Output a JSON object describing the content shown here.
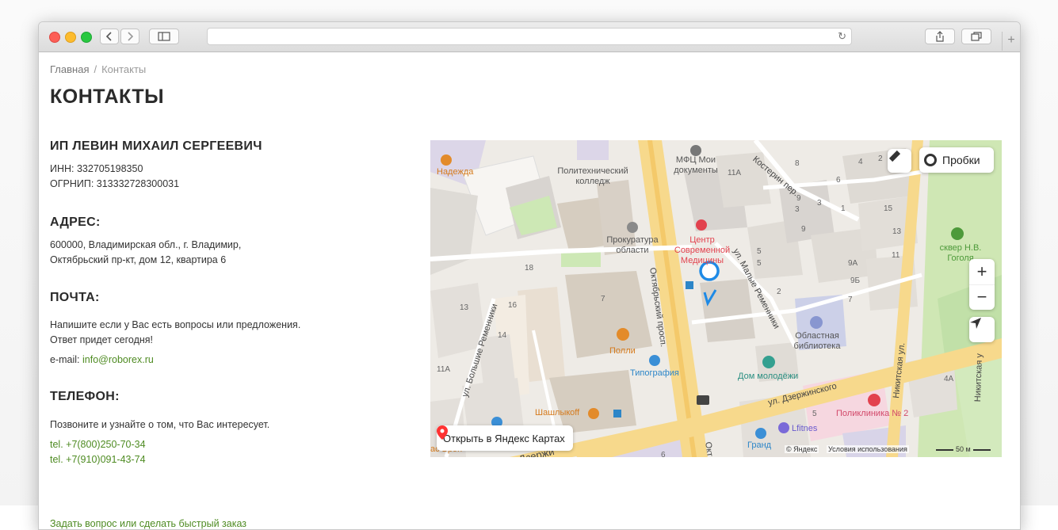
{
  "browser": {
    "back_icon": "chevron-left-icon",
    "forward_icon": "chevron-right-icon",
    "sidebar_icon": "sidebar-icon",
    "reload_icon": "reload-icon",
    "share_icon": "share-icon",
    "tabs_icon": "tabs-icon",
    "new_tab_icon": "plus-icon",
    "url": ""
  },
  "breadcrumbs": {
    "home": "Главная",
    "separator": "/",
    "current": "Контакты"
  },
  "page_title": "КОНТАКТЫ",
  "company": {
    "heading": "ИП ЛЕВИН МИХАИЛ СЕРГЕЕВИЧ",
    "inn": "ИНН: 332705198350",
    "ogrnip": "ОГРНИП: 313332728300031"
  },
  "address": {
    "heading": "АДРЕС:",
    "line1": "600000, Владимирская обл., г. Владимир,",
    "line2": "Октябрьский пр-кт, дом 12, квартира 6"
  },
  "mail": {
    "heading": "ПОЧТА:",
    "line1": "Напишите если у Вас есть вопросы или предложения.",
    "line2": "Ответ придет сегодня!",
    "email_label": "e-mail:",
    "email": "info@roborex.ru"
  },
  "phone": {
    "heading": "ТЕЛЕФОН:",
    "intro": "Позвоните и узнайте о том, что Вас интересует.",
    "tel1": "tel. +7(800)250-70-34",
    "tel2": "tel. +7(910)091-43-74"
  },
  "quick_order_link": "Задать вопрос или сделать быстрый заказ",
  "map": {
    "traffic_button": "Пробки",
    "open_button": "Открыть в Яндекс Картах",
    "copyright": "© Яндекс",
    "terms": "Условия использования",
    "scale": "50 м",
    "zoom_in": "+",
    "zoom_out": "−",
    "labels": {
      "nadezhda": "Надежда",
      "politech": "Политехнический колледж",
      "mfc": "МФЦ Мои документы",
      "prokuratura": "Прокуратура области",
      "center": "Центр Современной Медицины",
      "library": "Областная библиотека",
      "polli": "Полли",
      "tipografia": "Типография",
      "dom_molodezhi": "Дом молодёжи",
      "shashlykoff": "Шашлыкoff",
      "poliklinika": "Поликлиника № 2",
      "lfitnes": "Lfitnes",
      "grand": "Гранд",
      "skver": "сквер Н.В. Гоголя",
      "bron": "ас Брон"
    },
    "streets": {
      "kosterin": "Костерин пер.",
      "oktyabrsky": "Октябрьский просп.",
      "malye": "ул. Малые Ременники",
      "bolshie": "ул. Большие Ременники",
      "dzerzhinskogo": "ул. Дзержинского",
      "nikitskaya": "Никитская ул.",
      "nikitskaya2": "Никитская у",
      "dzerzh2": "Дзержи",
      "okt2": "Окт"
    },
    "numbers": [
      "11А",
      "8",
      "4",
      "2",
      "6",
      "5",
      "1",
      "15",
      "3",
      "9",
      "13",
      "11",
      "9А",
      "9Б",
      "7",
      "2",
      "18",
      "16",
      "7",
      "14",
      "13",
      "11А",
      "5",
      "4А",
      "6",
      "3",
      "5",
      "9"
    ]
  }
}
